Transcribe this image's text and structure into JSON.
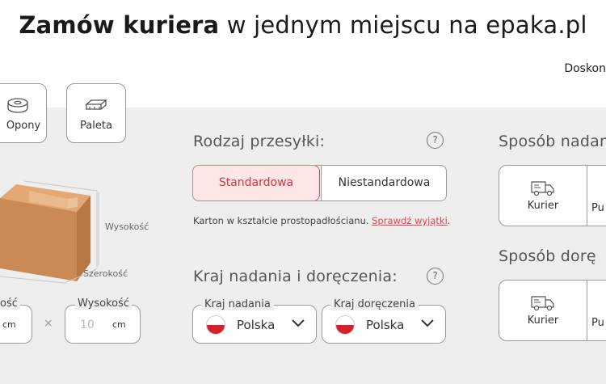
{
  "header": {
    "title_bold": "Zamów kuriera",
    "title_rest": "w jednym miejscu na epaka.pl",
    "top_right_text": "Doskon"
  },
  "package_types": [
    {
      "label": "Opony",
      "icon": "tire-icon"
    },
    {
      "label": "Paleta",
      "icon": "pallet-icon"
    }
  ],
  "dimensions": {
    "labels": {
      "height": "Wysokość",
      "width": "Szerokość"
    },
    "length_field": {
      "legend": "ość",
      "unit": "cm"
    },
    "times_symbol": "×",
    "height_field": {
      "legend": "Wysokość",
      "placeholder": "10",
      "unit": "cm"
    }
  },
  "shipment_type": {
    "title": "Rodzaj przesyłki:",
    "help": "?",
    "options": [
      {
        "label": "Standardowa",
        "selected": true
      },
      {
        "label": "Niestandardowa",
        "selected": false
      }
    ],
    "description": "Karton w kształcie prostopadłościanu.",
    "link_text": "Sprawdź wyjątki",
    "description_end": "."
  },
  "countries": {
    "title": "Kraj nadania i doręczenia:",
    "help": "?",
    "origin": {
      "legend": "Kraj nadania",
      "value": "Polska",
      "flag": "poland-flag-icon"
    },
    "destination": {
      "legend": "Kraj doręczenia",
      "value": "Polska",
      "flag": "poland-flag-icon"
    }
  },
  "sending_method": {
    "title": "Sposób nadan",
    "options": [
      {
        "label": "Kurier",
        "icon": "truck-icon"
      },
      {
        "label": "Pu",
        "icon": ""
      }
    ]
  },
  "delivery_method": {
    "title": "Sposób dorę",
    "options": [
      {
        "label": "Kurier",
        "icon": "truck-icon"
      },
      {
        "label": "Pu",
        "icon": ""
      }
    ]
  },
  "colors": {
    "accent": "#e0444e",
    "panel_bg": "#eeeeee",
    "selected_bg": "#fde6e6"
  }
}
